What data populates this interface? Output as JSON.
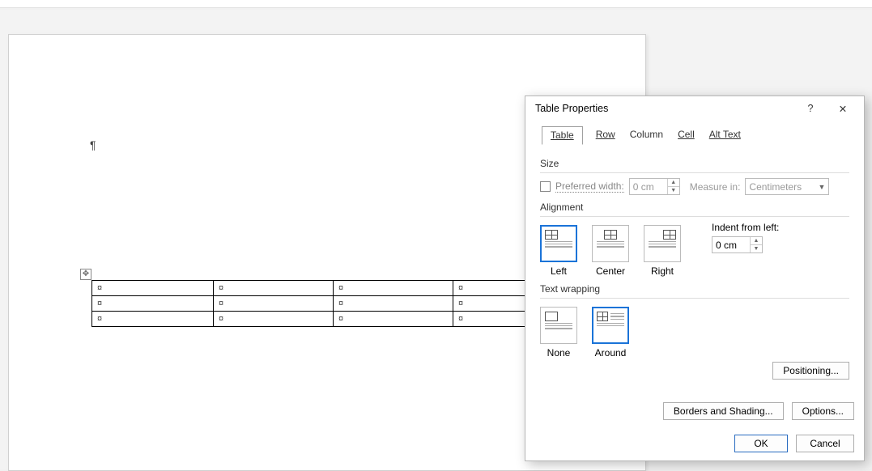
{
  "document": {
    "pilcrow": "¶",
    "table_handle_glyph": "✥",
    "cell_marker": "¤",
    "rows": 3,
    "cols": 4
  },
  "dialog": {
    "title": "Table Properties",
    "help_glyph": "?",
    "close_glyph": "✕",
    "tabs": {
      "table": "Table",
      "row": "Row",
      "column": "Column",
      "cell": "Cell",
      "alt_text": "Alt Text"
    },
    "size": {
      "label": "Size",
      "preferred_width_label": "Preferred width:",
      "preferred_width_value": "0 cm",
      "measure_in_label": "Measure in:",
      "measure_in_value": "Centimeters"
    },
    "alignment": {
      "label": "Alignment",
      "left": "Left",
      "center": "Center",
      "right": "Right",
      "indent_from_left_label": "Indent from left:",
      "indent_value": "0 cm"
    },
    "wrapping": {
      "label": "Text wrapping",
      "none": "None",
      "around": "Around",
      "positioning_btn": "Positioning..."
    },
    "buttons": {
      "borders_shading": "Borders and Shading...",
      "options": "Options...",
      "ok": "OK",
      "cancel": "Cancel"
    },
    "state": {
      "active_tab": "table",
      "alignment_selected": "left",
      "wrapping_selected": "around",
      "preferred_width_checked": false
    }
  }
}
